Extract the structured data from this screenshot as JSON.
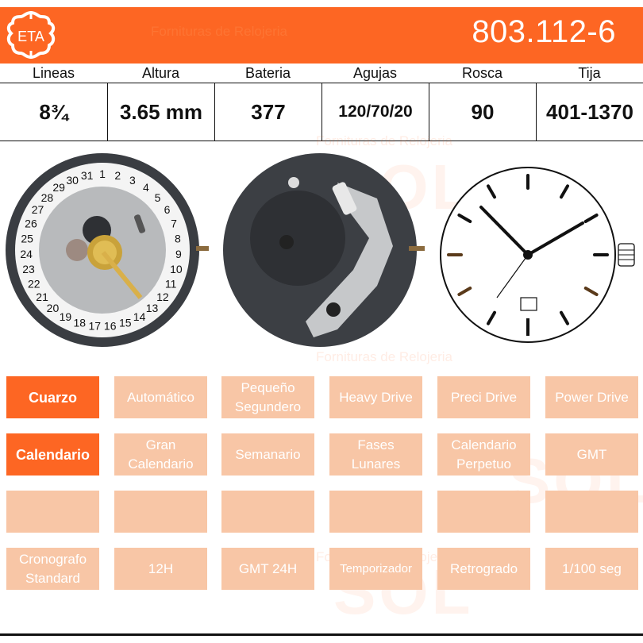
{
  "header": {
    "brand": "ETA",
    "model": "803.112-6",
    "watermark": "Fornituras de Relojeria",
    "watermark_logo": "SOL"
  },
  "specs": [
    {
      "label": "Lineas",
      "value": "8¾"
    },
    {
      "label": "Altura",
      "value": "3.65 mm"
    },
    {
      "label": "Bateria",
      "value": "377"
    },
    {
      "label": "Agujas",
      "value": "120/70/20"
    },
    {
      "label": "Rosca",
      "value": "90"
    },
    {
      "label": "Tija",
      "value": "401-1370"
    }
  ],
  "images": [
    {
      "name": "movement-dial-side",
      "description": "Movement with date disc (1-31)"
    },
    {
      "name": "movement-back-side",
      "description": "Movement rear with battery"
    },
    {
      "name": "dial-diagram",
      "description": "Watch face diagram with date window at 6"
    }
  ],
  "features": [
    {
      "label": "Cuarzo",
      "active": true
    },
    {
      "label": "Automático",
      "active": false
    },
    {
      "label": "Pequeño Segundero",
      "active": false
    },
    {
      "label": "Heavy Drive",
      "active": false
    },
    {
      "label": "Preci Drive",
      "active": false
    },
    {
      "label": "Power Drive",
      "active": false
    },
    {
      "label": "Calendario",
      "active": true
    },
    {
      "label": "Gran Calendario",
      "active": false
    },
    {
      "label": "Semanario",
      "active": false
    },
    {
      "label": "Fases Lunares",
      "active": false
    },
    {
      "label": "Calendario Perpetuo",
      "active": false
    },
    {
      "label": "GMT",
      "active": false
    },
    {
      "label": "",
      "active": false
    },
    {
      "label": "",
      "active": false
    },
    {
      "label": "",
      "active": false
    },
    {
      "label": "",
      "active": false
    },
    {
      "label": "",
      "active": false
    },
    {
      "label": "",
      "active": false
    },
    {
      "label": "Cronografo Standard",
      "active": false
    },
    {
      "label": "12H",
      "active": false
    },
    {
      "label": "GMT 24H",
      "active": false
    },
    {
      "label": "Temporizador",
      "active": false
    },
    {
      "label": "Retrogrado",
      "active": false
    },
    {
      "label": "1/100 seg",
      "active": false
    }
  ],
  "colors": {
    "accent": "#fd6623",
    "inactive_tile": "#f8c6a6"
  }
}
